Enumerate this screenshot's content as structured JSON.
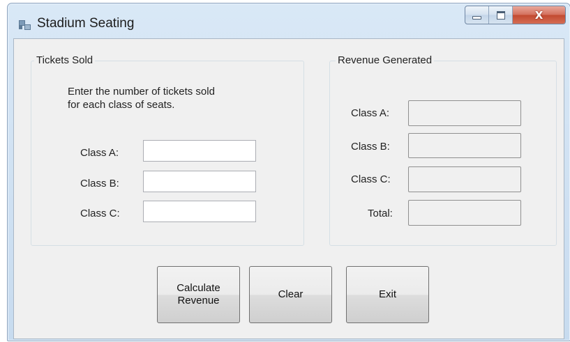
{
  "window": {
    "title": "Stadium Seating",
    "icon": "form-icon",
    "controls": {
      "minimize": "minimize-icon",
      "maximize": "maximize-icon",
      "close": "close-icon",
      "close_glyph": "X"
    }
  },
  "tickets_group": {
    "legend": "Tickets Sold",
    "instructions": "Enter the number of tickets sold\nfor each class of seats.",
    "rows": [
      {
        "label": "Class A:",
        "value": ""
      },
      {
        "label": "Class B:",
        "value": ""
      },
      {
        "label": "Class C:",
        "value": ""
      }
    ]
  },
  "revenue_group": {
    "legend": "Revenue Generated",
    "rows": [
      {
        "label": "Class A:",
        "value": ""
      },
      {
        "label": "Class B:",
        "value": ""
      },
      {
        "label": "Class C:",
        "value": ""
      },
      {
        "label": "Total:",
        "value": ""
      }
    ]
  },
  "buttons": {
    "calculate": "Calculate\nRevenue",
    "clear": "Clear",
    "exit": "Exit"
  }
}
